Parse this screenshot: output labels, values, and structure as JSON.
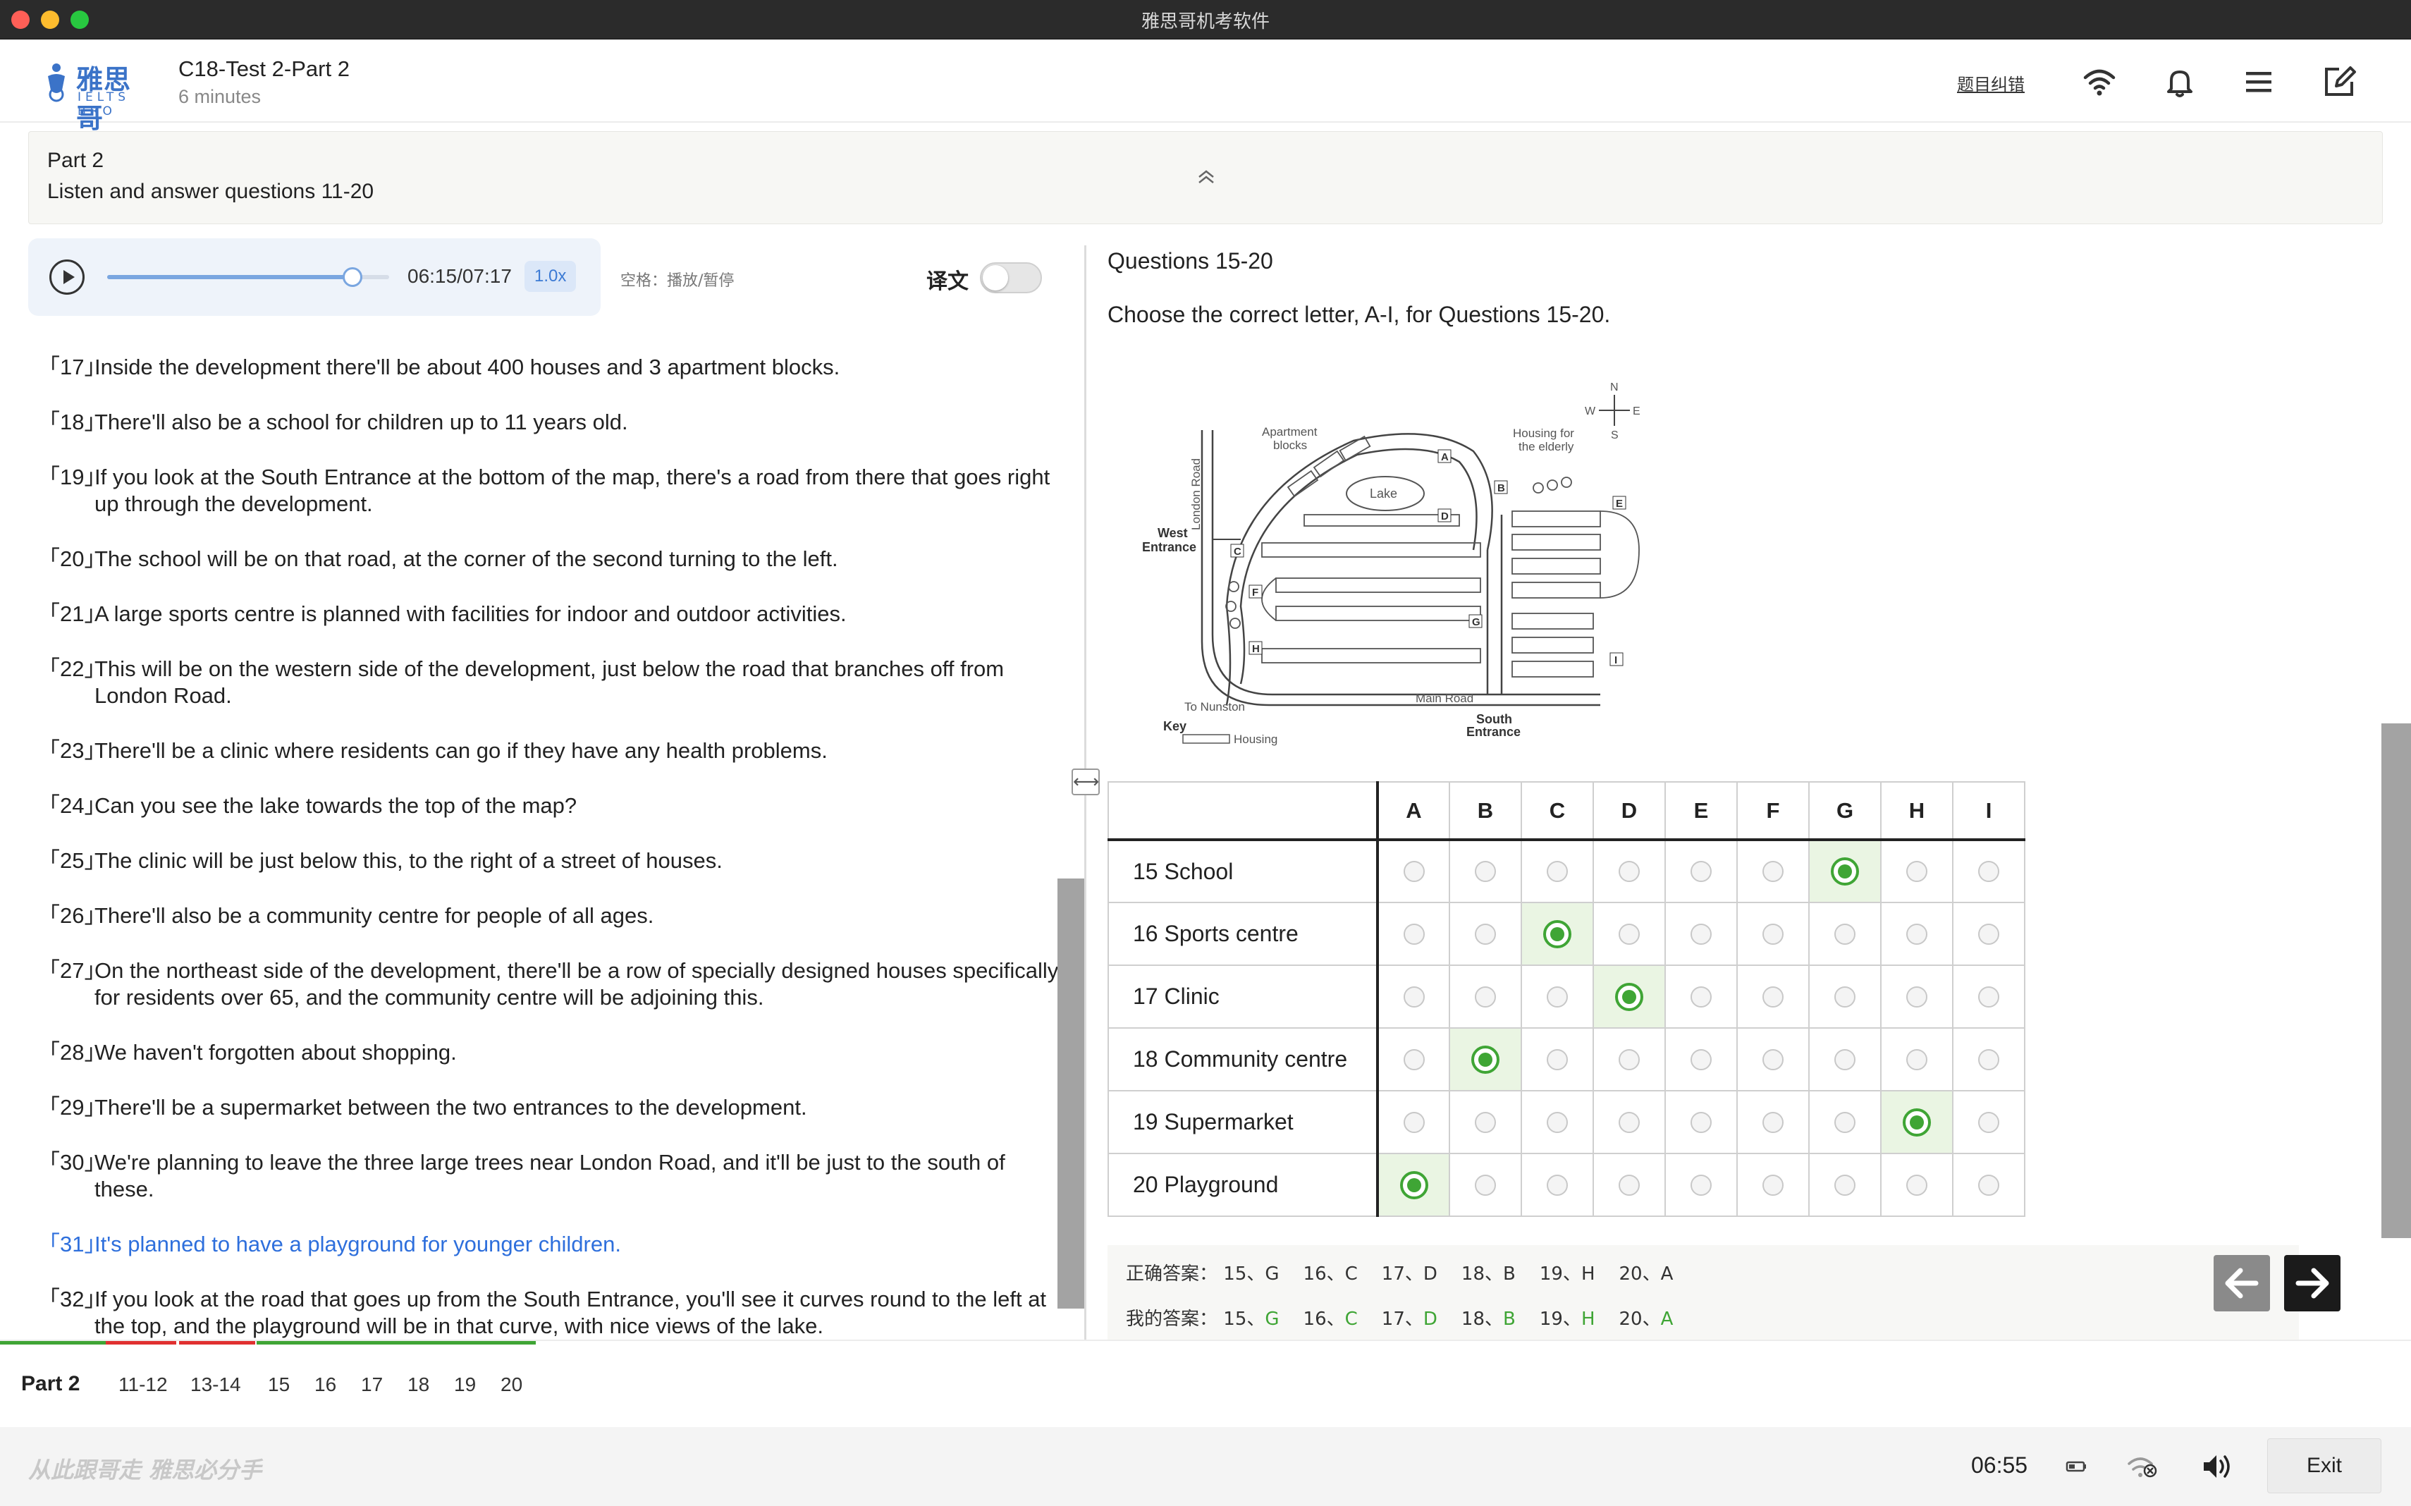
{
  "window": {
    "title": "雅思哥机考软件"
  },
  "header": {
    "logo_cn": "雅思哥",
    "logo_en": "IELTS BRO",
    "test_title": "C18-Test 2-Part 2",
    "duration": "6 minutes",
    "report_error": "题目纠错",
    "icons": [
      "wifi-icon",
      "bell-icon",
      "menu-icon",
      "edit-icon"
    ]
  },
  "banner": {
    "part": "Part 2",
    "instruction": "Listen and answer questions 11-20"
  },
  "player": {
    "time": "06:15/07:17",
    "progress": 0.8695,
    "speed": "1.0x",
    "shortcut_hint": "空格：播放/暂停",
    "translate_label": "译文",
    "translate_on": false
  },
  "transcript": [
    {
      "num": "「17」",
      "text": "Inside the development there'll be about 400 houses and 3 apartment blocks."
    },
    {
      "num": "「18」",
      "text": "There'll also be a school for children up to 11 years old."
    },
    {
      "num": "「19」",
      "text": "If you look at the South Entrance at the bottom of the map, there's a road from there that goes right up through the development."
    },
    {
      "num": "「20」",
      "text": "The school will be on that road, at the corner of the second turning to the left."
    },
    {
      "num": "「21」",
      "text": "A large sports centre is planned with facilities for indoor and outdoor activities."
    },
    {
      "num": "「22」",
      "text": "This will be on the western side of the development, just below the road that branches off from London Road."
    },
    {
      "num": "「23」",
      "text": "There'll be a clinic where residents can go if they have any health problems."
    },
    {
      "num": "「24」",
      "text": "Can you see the lake towards the top of the map?"
    },
    {
      "num": "「25」",
      "text": "The clinic will be just below this, to the right of a street of houses."
    },
    {
      "num": "「26」",
      "text": "There'll also be a community centre for people of all ages."
    },
    {
      "num": "「27」",
      "text": "On the northeast side of the development, there'll be a row of specially designed houses specifically for residents over 65, and the community centre will be adjoining this."
    },
    {
      "num": "「28」",
      "text": "We haven't forgotten about shopping."
    },
    {
      "num": "「29」",
      "text": "There'll be a supermarket between the two entrances to the development."
    },
    {
      "num": "「30」",
      "text": "We're planning to leave the three large trees near London Road, and it'll be just to the south of these."
    },
    {
      "num": "「31」",
      "text": "It's planned to have a playground for younger children."
    },
    {
      "num": "「32」",
      "text": "If you look at the road that goes up from the South Entrance, you'll see it curves round to the left at the top, and the playground will be in that curve, with nice views of the lake."
    }
  ],
  "questions": {
    "heading": "Questions 15-20",
    "instruction": "Choose the correct letter, A-I, for Questions 15-20.",
    "map_labels": {
      "n": "N",
      "s": "S",
      "e": "E",
      "w": "W",
      "apartment": "Apartment",
      "blocks": "blocks",
      "housing_for": "Housing for",
      "the_elderly": "the elderly",
      "lake": "Lake",
      "london_road": "London Road",
      "west": "West",
      "entrance": "Entrance",
      "to_nunston": "To Nunston",
      "main_road": "Main Road",
      "south": "South",
      "key": "Key",
      "housing": "Housing",
      "letters": [
        "A",
        "B",
        "C",
        "D",
        "E",
        "F",
        "G",
        "H",
        "I"
      ]
    },
    "columns": [
      "A",
      "B",
      "C",
      "D",
      "E",
      "F",
      "G",
      "H",
      "I"
    ],
    "rows": [
      {
        "label": "15 School",
        "selected": "G"
      },
      {
        "label": "16 Sports centre",
        "selected": "C"
      },
      {
        "label": "17 Clinic",
        "selected": "D"
      },
      {
        "label": "18 Community centre",
        "selected": "B"
      },
      {
        "label": "19 Supermarket",
        "selected": "H"
      },
      {
        "label": "20 Playground",
        "selected": "A"
      }
    ]
  },
  "answers": {
    "correct_label": "正确答案：",
    "mine_label": "我的答案：",
    "correct": [
      {
        "q": "15、",
        "a": "G"
      },
      {
        "q": "16、",
        "a": "C"
      },
      {
        "q": "17、",
        "a": "D"
      },
      {
        "q": "18、",
        "a": "B"
      },
      {
        "q": "19、",
        "a": "H"
      },
      {
        "q": "20、",
        "a": "A"
      }
    ],
    "mine": [
      {
        "q": "15、",
        "a": "G"
      },
      {
        "q": "16、",
        "a": "C"
      },
      {
        "q": "17、",
        "a": "D"
      },
      {
        "q": "18、",
        "a": "B"
      },
      {
        "q": "19、",
        "a": "H"
      },
      {
        "q": "20、",
        "a": "A"
      }
    ]
  },
  "question_nav": {
    "part": "Part 2",
    "items": [
      "11-12",
      "13-14",
      "15",
      "16",
      "17",
      "18",
      "19",
      "20"
    ]
  },
  "footer": {
    "slogan": "从此跟哥走  雅思必分手",
    "timer": "06:55",
    "exit": "Exit"
  },
  "colors": {
    "accent_blue": "#2e6fdc",
    "correct_green": "#3fa535",
    "wrong_red": "#e03030"
  }
}
